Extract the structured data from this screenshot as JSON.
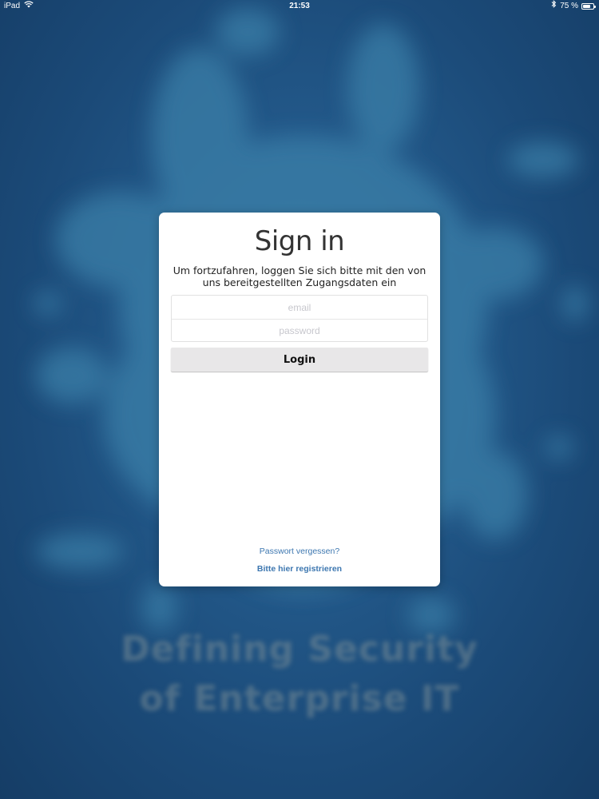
{
  "status_bar": {
    "device": "iPad",
    "time": "21:53",
    "battery_percent": "75 %",
    "battery_level": 0.75,
    "icons": [
      "wifi-icon",
      "bluetooth-icon",
      "battery-icon"
    ]
  },
  "background": {
    "tagline_line1": "Defining Security",
    "tagline_line2": "of Enterprise IT",
    "colors": {
      "base": "#1e4f7a",
      "splash": "#3a7fa8"
    }
  },
  "login_card": {
    "title": "Sign in",
    "subtitle": "Um fortzufahren, loggen Sie sich bitte mit den von uns bereitgestellten Zugangsdaten ein",
    "email_placeholder": "email",
    "email_value": "",
    "password_placeholder": "password",
    "password_value": "",
    "login_label": "Login",
    "forgot_password_label": "Passwort vergessen?",
    "register_label": "Bitte hier registrieren",
    "colors": {
      "link": "#3d77b0",
      "button_bg": "#e8e7e8"
    }
  }
}
